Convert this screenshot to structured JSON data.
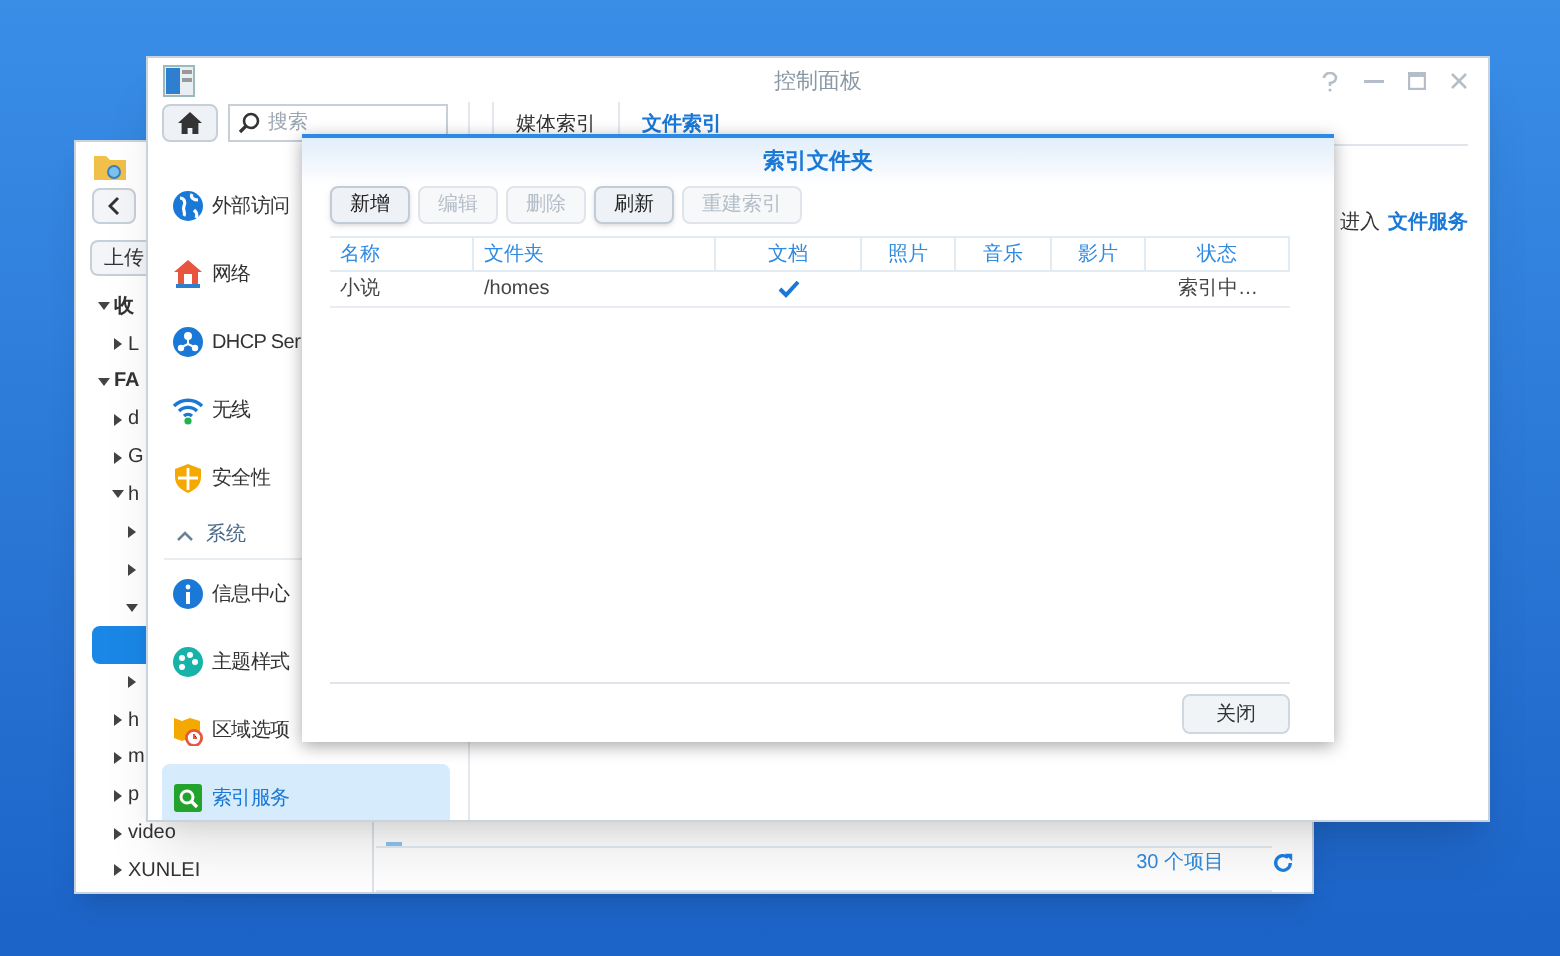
{
  "file_window": {
    "upload_button": "上传",
    "tree": [
      {
        "label": "收",
        "expanded": true,
        "selected": false,
        "children": [
          {
            "label": "L",
            "expanded": false,
            "selected": false
          }
        ]
      },
      {
        "label": "FA",
        "expanded": true,
        "selected": false,
        "children": [
          {
            "label": "d",
            "expanded": false,
            "selected": false
          },
          {
            "label": "G",
            "expanded": false,
            "selected": false
          },
          {
            "label": "h",
            "expanded": true,
            "selected": false,
            "children": [
              {
                "expanded": false,
                "selected": false
              },
              {
                "expanded": false,
                "selected": false
              },
              {
                "expanded": true,
                "selected": false,
                "children": [
                  {
                    "selected": true
                  }
                ]
              },
              {
                "expanded": false,
                "selected": false
              }
            ]
          },
          {
            "label": "h",
            "expanded": false,
            "selected": false
          },
          {
            "label": "m",
            "expanded": false,
            "selected": false
          },
          {
            "label": "p",
            "expanded": false,
            "selected": false
          },
          {
            "label": "video",
            "expanded": false,
            "selected": false
          },
          {
            "label": "XUNLEI",
            "expanded": false,
            "selected": false
          }
        ]
      }
    ],
    "item_count": "30 个项目"
  },
  "control_panel": {
    "title": "控制面板",
    "search": {
      "placeholder": "搜索"
    },
    "sidebar": [
      {
        "kind": "item",
        "label": "外部访问",
        "selected": false
      },
      {
        "kind": "item",
        "label": "网络",
        "selected": false
      },
      {
        "kind": "item",
        "label": "DHCP Ser",
        "selected": false
      },
      {
        "kind": "item",
        "label": "无线",
        "selected": false
      },
      {
        "kind": "item",
        "label": "安全性",
        "selected": false
      },
      {
        "kind": "section",
        "label": "系统",
        "expanded": true
      },
      {
        "kind": "item",
        "label": "信息中心",
        "selected": false
      },
      {
        "kind": "item",
        "label": "主题样式",
        "selected": false
      },
      {
        "kind": "item",
        "label": "区域选项",
        "selected": false
      },
      {
        "kind": "item",
        "label": "索引服务",
        "selected": true
      }
    ],
    "tabs": [
      {
        "label": "媒体索引",
        "selected": false
      },
      {
        "label": "文件索引",
        "selected": true
      }
    ],
    "hint": {
      "text": "进入",
      "link": "文件服务"
    }
  },
  "dialog": {
    "title": "索引文件夹",
    "buttons": [
      {
        "label": "新增",
        "disabled": false
      },
      {
        "label": "编辑",
        "disabled": true
      },
      {
        "label": "删除",
        "disabled": true
      },
      {
        "label": "刷新",
        "disabled": false
      },
      {
        "label": "重建索引",
        "disabled": true
      }
    ],
    "table": {
      "columns": [
        "名称",
        "文件夹",
        "文档",
        "照片",
        "音乐",
        "影片",
        "状态"
      ],
      "rows": [
        {
          "name": "小说",
          "folder": "/homes",
          "documents": true,
          "photos": false,
          "music": false,
          "videos": false,
          "status": "索引中…"
        }
      ]
    },
    "close_button": "关闭"
  }
}
